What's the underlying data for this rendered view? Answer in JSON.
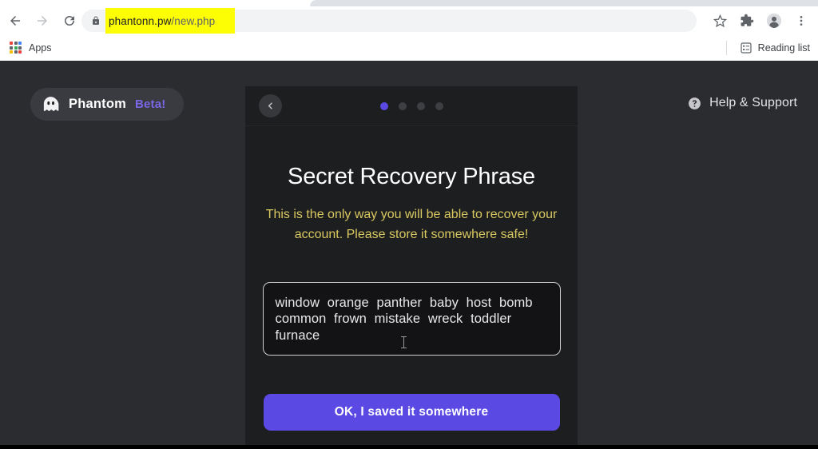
{
  "browser": {
    "back_tooltip": "Back",
    "forward_tooltip": "Forward",
    "reload_tooltip": "Reload",
    "url_domain": "phantonn.pw",
    "url_path": "/new.php",
    "url_highlight_color": "#fdfd04",
    "lock_icon": "lock-icon",
    "bookmark_icon": "star-icon",
    "extensions_icon": "puzzle-icon",
    "profile_icon": "avatar-icon",
    "menu_icon": "three-dot-menu-icon",
    "bookmarks": {
      "apps_label": "Apps",
      "apps_icon": "apps-grid-icon",
      "reading_list_label": "Reading list",
      "reading_list_icon": "reading-list-icon"
    }
  },
  "page": {
    "background_color": "#2b2c30",
    "brand": {
      "icon": "phantom-ghost-icon",
      "name": "Phantom",
      "beta": "Beta!",
      "beta_color": "#7c66e8"
    },
    "help": {
      "icon": "question-circle-icon",
      "label": "Help & Support"
    }
  },
  "modal": {
    "back_icon": "chevron-left-icon",
    "steps": {
      "total": 4,
      "active_index": 0,
      "active_color": "#5a4ae3",
      "inactive_color": "#3e3f43"
    },
    "title": "Secret Recovery Phrase",
    "warning": "This is the only way you will be able to recover your account. Please store it somewhere safe!",
    "warning_color": "#d9c860",
    "seed_phrase": "window orange panther baby host bomb common frown mistake wreck toddler furnace",
    "seed_words": [
      "window",
      "orange",
      "panther",
      "baby",
      "host",
      "bomb",
      "common",
      "frown",
      "mistake",
      "wreck",
      "toddler",
      "furnace"
    ],
    "confirm_button": "OK, I saved it somewhere",
    "confirm_button_color": "#5a4ae3"
  }
}
